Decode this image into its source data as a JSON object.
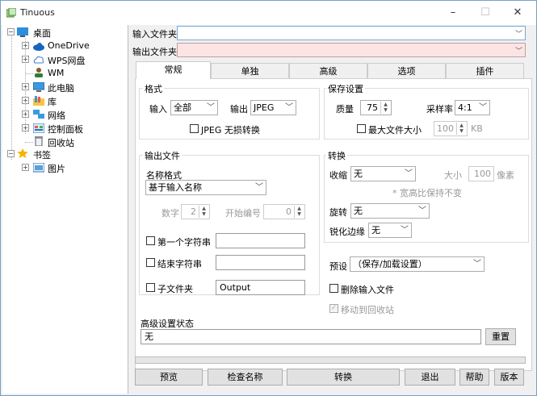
{
  "window": {
    "title": "Tinuous",
    "minimize": "–",
    "maximize": "☐",
    "close": "✕"
  },
  "tree": {
    "root": "桌面",
    "items": [
      "OneDrive",
      "WPS网盘",
      "WM",
      "此电脑",
      "库",
      "网络",
      "控制面板",
      "回收站"
    ],
    "bookmarks": "书签",
    "bookmark_items": [
      "图片"
    ]
  },
  "paths": {
    "input_label": "输入文件夹",
    "output_label": "输出文件夹",
    "input_value": "",
    "output_value": ""
  },
  "tabs": [
    "常规",
    "单独",
    "高级",
    "选项",
    "插件"
  ],
  "format": {
    "group": "格式",
    "input_label": "输入",
    "input_value": "全部",
    "output_label": "输出",
    "output_value": "JPEG",
    "lossless_label": "JPEG 无损转换"
  },
  "save": {
    "group": "保存设置",
    "quality_label": "质量",
    "quality_value": "75",
    "sampling_label": "采样率",
    "sampling_value": "4:1",
    "max_size_label": "最大文件大小",
    "max_size_value": "100",
    "max_size_unit": "KB"
  },
  "output_file": {
    "group": "输出文件",
    "name_format_label": "名称格式",
    "name_format_value": "基于输入名称",
    "digits_label": "数字",
    "digits_value": "2",
    "start_label": "开始编号",
    "start_value": "0",
    "first_string_label": "第一个字符串",
    "end_string_label": "结束字符串",
    "subfolder_label": "子文件夹",
    "subfolder_value": "Output"
  },
  "convert": {
    "group": "转换",
    "scale_label": "收缩",
    "scale_value": "无",
    "size_label": "大小",
    "size_value": "100",
    "size_unit": "像素",
    "aspect_note": "* 宽高比保持不变",
    "rotate_label": "旋转",
    "rotate_value": "无",
    "sharpen_label": "锐化边缘",
    "sharpen_value": "无"
  },
  "preset": {
    "label": "预设",
    "value": "（保存/加载设置）"
  },
  "delete_input_label": "删除输入文件",
  "move_recycle_label": "移动到回收站",
  "advanced_status": {
    "label": "高级设置状态",
    "value": "无",
    "reset": "重置"
  },
  "buttons": {
    "preview": "预览",
    "check_names": "检查名称",
    "convert": "转换",
    "exit": "退出",
    "help": "帮助",
    "version": "版本"
  }
}
